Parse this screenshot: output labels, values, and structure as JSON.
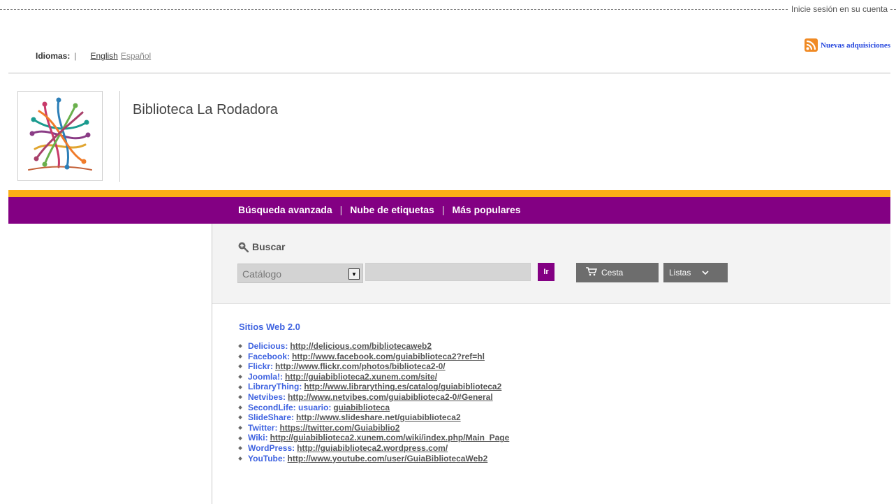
{
  "header": {
    "login": "Inicie sesión en su cuenta",
    "rss": "Nuevas adquisiciones"
  },
  "languages": {
    "title": "Idiomas:",
    "separator": "|",
    "english": "English",
    "spanish": "Español"
  },
  "library": {
    "name": "Biblioteca La Rodadora"
  },
  "nav": {
    "items": [
      "Búsqueda avanzada",
      "Nube de etiquetas",
      "Más populares"
    ],
    "separator": "|"
  },
  "search": {
    "title": "Buscar",
    "scope": "Catálogo",
    "query": "",
    "go": "Ir",
    "cart": "Cesta",
    "lists": "Listas"
  },
  "content": {
    "title": "Sitios Web 2.0",
    "sites": [
      {
        "name": "Delicious:",
        "url": "http://delicious.com/bibliotecaweb2"
      },
      {
        "name": "Facebook:",
        "url": "http://www.facebook.com/guiabiblioteca2?ref=hl"
      },
      {
        "name": "Flickr:",
        "url": "http://www.flickr.com/photos/biblioteca2-0/"
      },
      {
        "name": "Joomla!:",
        "url": "http://guiabiblioteca2.xunem.com/site/"
      },
      {
        "name": "LibraryThing:",
        "url": "http://www.librarything.es/catalog/guiabiblioteca2"
      },
      {
        "name": "Netvibes:",
        "url": "http://www.netvibes.com/guiabiblioteca2-0#General"
      },
      {
        "name": "SecondLife: usuario:",
        "url": "guiabiblioteca"
      },
      {
        "name": "SlideShare:",
        "url": "http://www.slideshare.net/guiabiblioteca2"
      },
      {
        "name": "Twitter:",
        "url": "https://twitter.com/Guiabiblio2"
      },
      {
        "name": "Wiki:",
        "url": "http://guiabiblioteca2.xunem.com/wiki/index.php/Main_Page"
      },
      {
        "name": "WordPress:",
        "url": "http://guiabiblioteca2.wordpress.com/"
      },
      {
        "name": "YouTube:",
        "url": "http://www.youtube.com/user/GuiaBibliotecaWeb2"
      }
    ]
  },
  "colors": {
    "brand_purple": "#830083",
    "accent_orange": "#fbae17",
    "link_blue": "#3f63e0"
  },
  "icons": {
    "rss": "rss-feed-icon",
    "search": "magnifier-plus-icon",
    "cart": "shopping-cart-icon",
    "dropdown": "chevron-down-icon"
  }
}
